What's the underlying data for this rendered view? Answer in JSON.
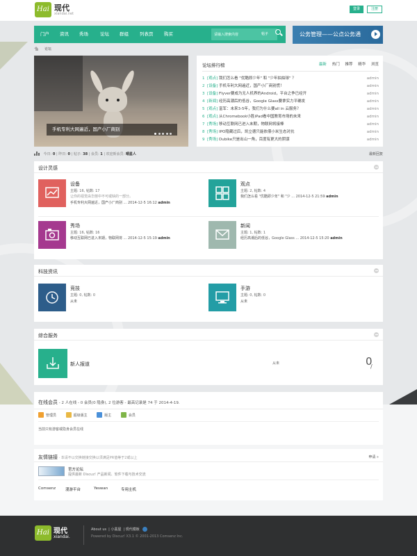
{
  "header": {
    "logo_text": "Hai",
    "site_name": "现代",
    "site_domain": "xiandai.net",
    "login_label": "登录",
    "register_label": "注册"
  },
  "nav": {
    "items": [
      "门户",
      "资讯",
      "秀场",
      "论坛",
      "群组",
      "列表页",
      "购买"
    ],
    "search_placeholder": "请输入搜索内容",
    "search_category": "帖子"
  },
  "banner": {
    "text": "公务管理——公点公务通"
  },
  "breadcrumb": {
    "current": "论坛"
  },
  "slider": {
    "caption": "手机专利大网遍近，国产小厂商别",
    "dot_count": 5,
    "active_dot": 0
  },
  "ranking": {
    "title": "论坛排行榜",
    "tabs": [
      "最新",
      "热门",
      "推荐",
      "精华",
      "浏览"
    ],
    "active_tab": 0,
    "items": [
      {
        "num": "1",
        "category": "[观点]",
        "title": "我们怎么看 \"优酷即少年\" 和 \"少年拍拍球\" ？",
        "user": "admin"
      },
      {
        "num": "2",
        "category": "[设备]",
        "title": "手机专利大网遍近，国产小厂商别慌！",
        "user": "admin"
      },
      {
        "num": "3",
        "category": "[设备]",
        "title": "Flyver要成为无人机界的Android，平台之争已经开",
        "user": "admin"
      },
      {
        "num": "4",
        "category": "[新闻]",
        "title": "经历高潮后的低谷，Google Glass要拿实力平确发",
        "user": "admin"
      },
      {
        "num": "5",
        "category": "[观点]",
        "title": "富军：未来3-5年，我们为什么要all in 云服务？",
        "user": "admin"
      },
      {
        "num": "6",
        "category": "[观点]",
        "title": "从Chromebook小胜iPad看中国教育市场的未来",
        "user": "admin"
      },
      {
        "num": "7",
        "category": "[秀场]",
        "title": "移动互联网已进入末期，物联网将接棒",
        "user": "admin"
      },
      {
        "num": "8",
        "category": "[秀场]",
        "title": "IPO隐藏过后，凯立德只能依偎小米生态对抗",
        "user": "admin"
      },
      {
        "num": "9",
        "category": "[秀场]",
        "title": "Dubike只是出山一角，百度有更大的阴谋",
        "user": "admin"
      }
    ]
  },
  "stats": {
    "today_label": "今日:",
    "today": "0",
    "yesterday_label": "昨日:",
    "yesterday": "0",
    "posts_label": "帖子:",
    "posts": "38",
    "members_label": "会员:",
    "members": "1",
    "welcome_label": "欢迎新会员:",
    "newest": "晴星人",
    "latest_label": "最新回复"
  },
  "sections": [
    {
      "title": "设计灵感",
      "forums": [
        {
          "name": "设备",
          "stats": "主题: 16, 帖数: 17",
          "desc": "让你的视觉由华丽中不可或缺的一部分。",
          "last_title": "手机专利大网遍近，国产小厂商别 ...",
          "last_time": "2014-12-5 16:12",
          "last_user": "admin",
          "color": "#e0615e"
        },
        {
          "name": "观点",
          "stats": "主题: 2, 帖数: 4",
          "desc": "",
          "last_title": "我们怎么看 \"优酷即少年\" 和 \"少 ...",
          "last_time": "2014-12-5 21:59",
          "last_user": "admin",
          "color": "#23a39a"
        },
        {
          "name": "秀场",
          "stats": "主题: 16, 帖数: 16",
          "desc": "",
          "last_title": "移动互联网已进入末期，物联网将 ...",
          "last_time": "2014-12-5 15:19",
          "last_user": "admin",
          "color": "#a5398f"
        },
        {
          "name": "新闻",
          "stats": "主题: 1, 帖数: 1",
          "desc": "",
          "last_title": "经历高潮后的低谷，Google Glass ...",
          "last_time": "2014-12-5 15:20",
          "last_user": "admin",
          "color": "#9fb8ae"
        }
      ]
    },
    {
      "title": "科技资讯",
      "forums": [
        {
          "name": "竞技",
          "stats": "主题: 0, 帖数: 0",
          "never": "从未",
          "color": "#2d5d8a"
        },
        {
          "name": "手游",
          "stats": "主题: 0, 帖数: 0",
          "never": "从未",
          "color": "#239da6"
        }
      ]
    },
    {
      "title": "综合服务",
      "forums": [
        {
          "name": "新人报道",
          "never": "从未",
          "count": "0",
          "color": "#27b08c"
        }
      ]
    }
  ],
  "online": {
    "title": "在线会员",
    "summary": "- 2 人在线 - 0 会员(0 隐身), 2 位游客 - 最高记录是 74 于 2014-4-19.",
    "legend": [
      {
        "label": "管理员",
        "color": "#f0a030"
      },
      {
        "label": "超级版主",
        "color": "#e9b844"
      },
      {
        "label": "版主",
        "color": "#4a90d9"
      },
      {
        "label": "会员",
        "color": "#7fb548"
      }
    ],
    "note": "当前只有游客或隐身会员在线"
  },
  "links": {
    "title": "友情链接",
    "hint": "· 本请不以交换链接交换以须满足PR值等于2或以上",
    "apply": "申请 »",
    "featured_name": "官方论坛",
    "featured_desc": "提供最新 Discuz! 产品新闻、软件下载与技术交流",
    "text_links": [
      "Comsenz",
      "漫游平台",
      "Yeswan",
      "专用主机"
    ]
  },
  "footer": {
    "logo_text": "Hai",
    "name": "现代",
    "domain": "xiandai.",
    "links": [
      "About us",
      "小黑屋",
      "现代模板"
    ],
    "copyright": "Powered by Discuz! X3.1 © 2001-2013 Comsenz Inc."
  }
}
